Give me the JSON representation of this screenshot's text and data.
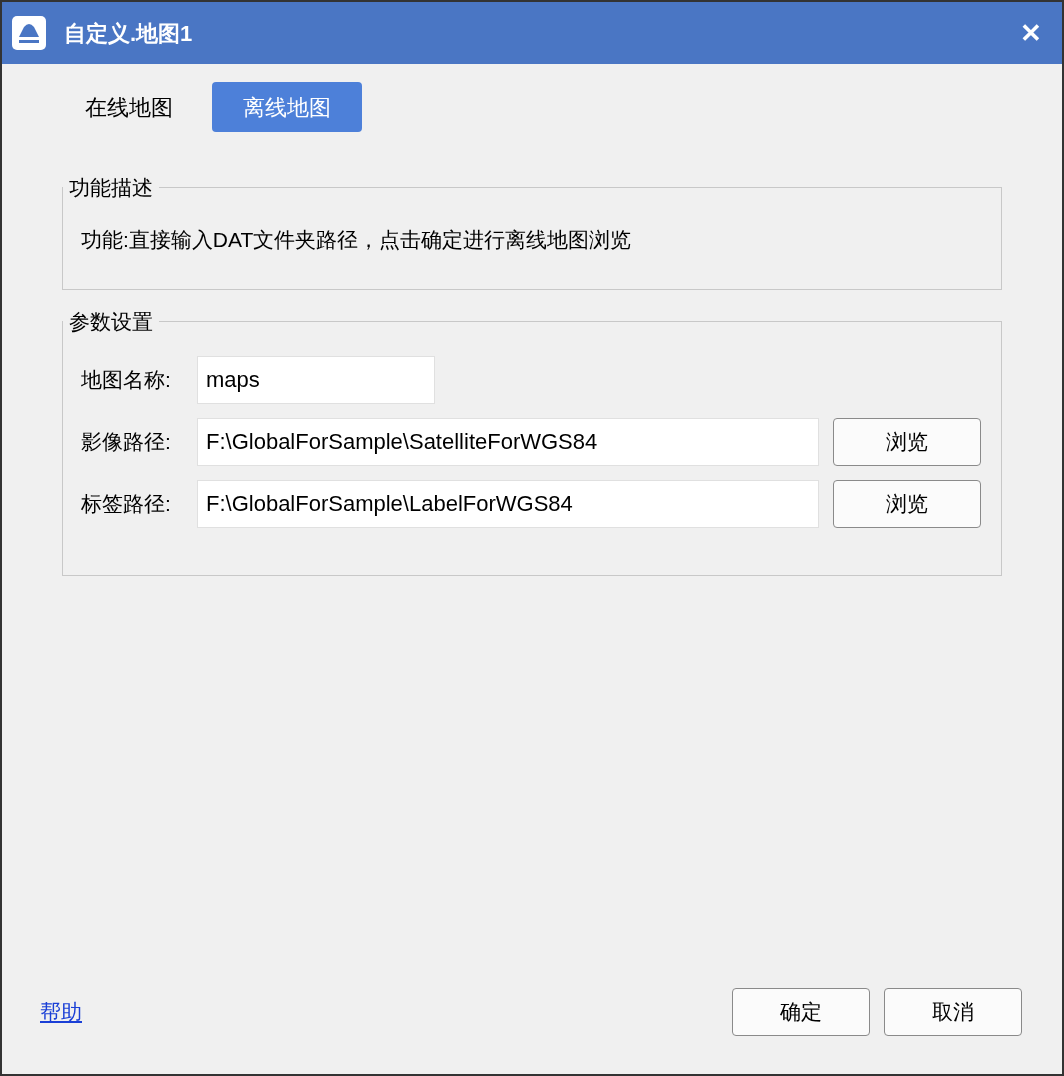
{
  "window": {
    "title": "自定义.地图1",
    "close": "✕"
  },
  "tabs": [
    {
      "label": "在线地图",
      "selected": false
    },
    {
      "label": "离线地图",
      "selected": true
    }
  ],
  "description_group": {
    "title": "功能描述",
    "text": "功能:直接输入DAT文件夹路径，点击确定进行离线地图浏览"
  },
  "params_group": {
    "title": "参数设置",
    "fields": [
      {
        "kind": "text",
        "label": "地图名称:",
        "value": "maps"
      },
      {
        "kind": "path",
        "label": "影像路径:",
        "value": "F:\\GlobalForSample\\SatelliteForWGS84",
        "button": "浏览"
      },
      {
        "kind": "path",
        "label": "标签路径:",
        "value": "F:\\GlobalForSample\\LabelForWGS84",
        "button": "浏览"
      }
    ]
  },
  "help_link": "帮助",
  "buttons": [
    "确定",
    "取消"
  ]
}
